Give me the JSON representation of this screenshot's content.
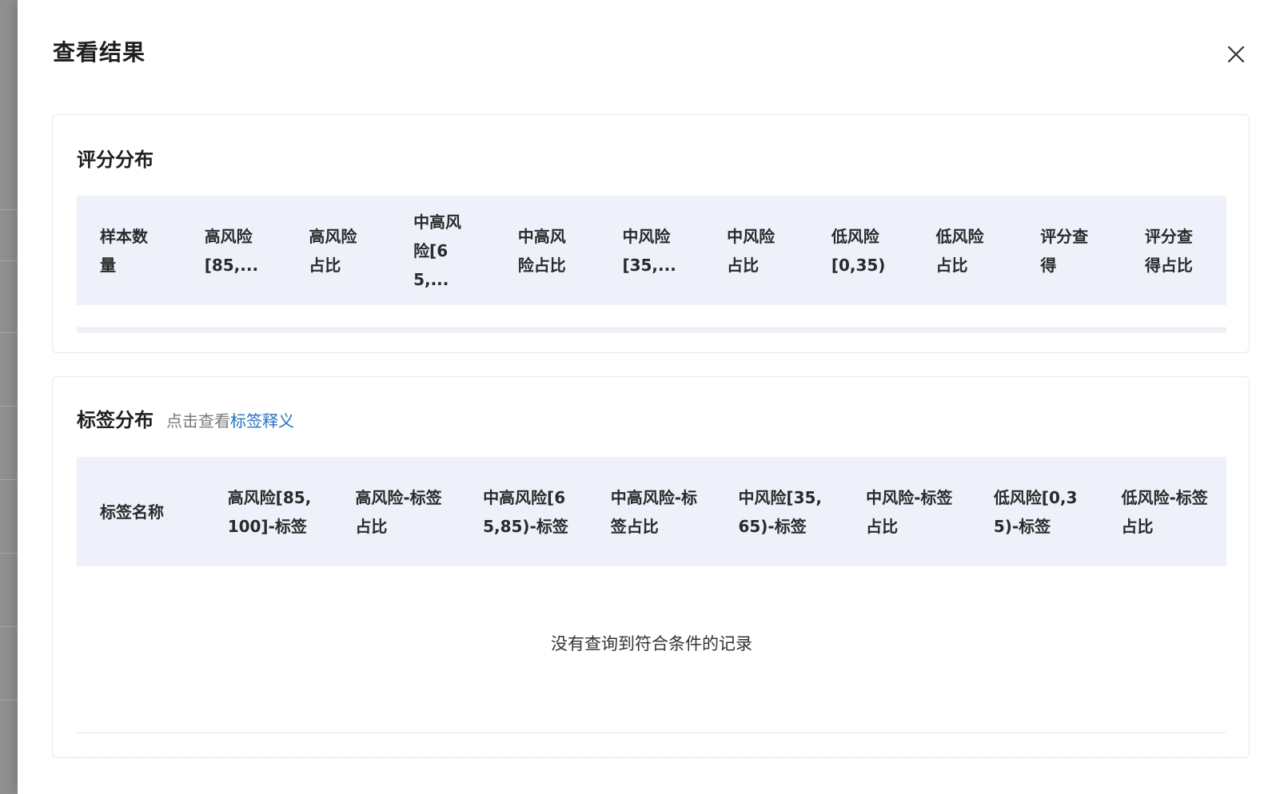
{
  "drawer": {
    "title": "查看结果",
    "close_icon": "close-icon"
  },
  "score_section": {
    "title": "评分分布",
    "columns": [
      "样本数量",
      "高风险[85,...",
      "高风险占比",
      "中高风险[65,...",
      "中高风险占比",
      "中风险[35,...",
      "中风险占比",
      "低风险[0,35)",
      "低风险占比",
      "评分查得",
      "评分查得占比"
    ]
  },
  "label_section": {
    "title": "标签分布",
    "hint_prefix": "点击查看",
    "hint_link": "标签释义",
    "columns": [
      "标签名称",
      "高风险[85,100]-标签",
      "高风险-标签占比",
      "中高风险[65,85)-标签",
      "中高风险-标签占比",
      "中风险[35,65)-标签",
      "中风险-标签占比",
      "低风险[0,35)-标签",
      "低风险-标签占比"
    ],
    "empty_text": "没有查询到符合条件的记录"
  },
  "colors": {
    "header_bg": "#eef1f9",
    "link": "#1e6fd9"
  }
}
